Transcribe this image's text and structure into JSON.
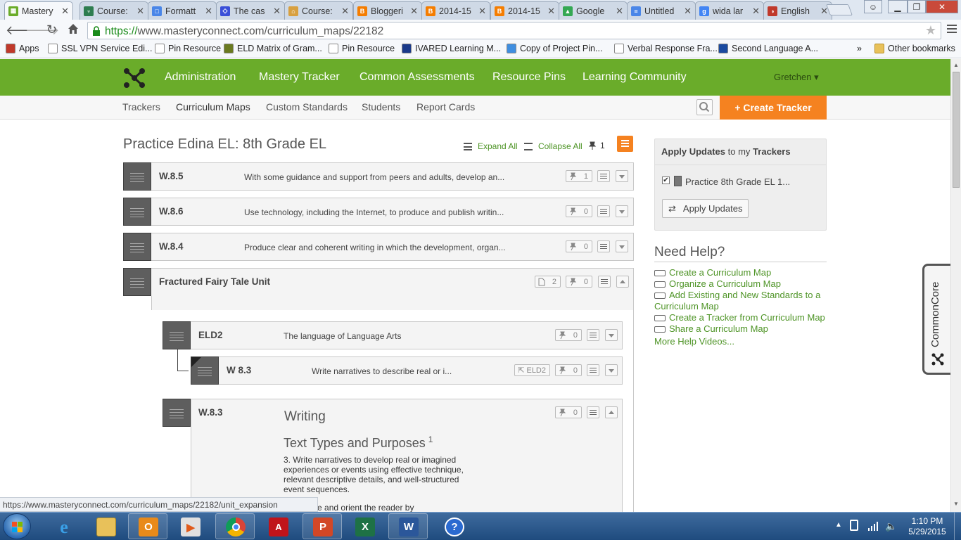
{
  "browser": {
    "tabs": [
      {
        "label": "Mastery",
        "color": "#6aac2a",
        "glyph": "▦"
      },
      {
        "label": "Course:",
        "color": "#2e7d4f",
        "glyph": "♆"
      },
      {
        "label": "Formatt",
        "color": "#4a86e8",
        "glyph": "□"
      },
      {
        "label": "The cas",
        "color": "#3a4fd8",
        "glyph": "◇"
      },
      {
        "label": "Course:",
        "color": "#d8a040",
        "glyph": "⌂"
      },
      {
        "label": "Bloggeri",
        "color": "#f57d00",
        "glyph": "B"
      },
      {
        "label": "2014-15",
        "color": "#f57d00",
        "glyph": "B"
      },
      {
        "label": "2014-15",
        "color": "#f57d00",
        "glyph": "B"
      },
      {
        "label": "Google",
        "color": "#34a853",
        "glyph": "▲"
      },
      {
        "label": "Untitled",
        "color": "#4a86e8",
        "glyph": "≡"
      },
      {
        "label": "wida lar",
        "color": "#4285f4",
        "glyph": "g"
      },
      {
        "label": "English",
        "color": "#c0392b",
        "glyph": "◑"
      }
    ],
    "url_https": "https://",
    "url_rest": "www.masteryconnect.com/curriculum_maps/22182",
    "bookmarks": [
      {
        "label": "Apps",
        "color": "#c0392b"
      },
      {
        "label": "SSL VPN Service Edi...",
        "color": "#ffffff"
      },
      {
        "label": "Pin Resource",
        "color": "#ffffff"
      },
      {
        "label": "ELD Matrix of Gram...",
        "color": "#6a7a20"
      },
      {
        "label": "Pin Resource",
        "color": "#ffffff"
      },
      {
        "label": "IVARED Learning M...",
        "color": "#1a3a8a"
      },
      {
        "label": "Copy of Project Pin...",
        "color": "#3f8ee0"
      },
      {
        "label": "Verbal Response Fra...",
        "color": "#ffffff"
      },
      {
        "label": "Second Language A...",
        "color": "#1a4aa0"
      }
    ],
    "bookmarks_more": "»",
    "other_bookmarks": "Other bookmarks",
    "status_url": "https://www.masteryconnect.com/curriculum_maps/22182/unit_expansion"
  },
  "nav": {
    "items": [
      "Administration",
      "Mastery Tracker",
      "Common Assessments",
      "Resource Pins",
      "Learning Community"
    ],
    "user": "Gretchen ▾",
    "subitems": [
      "Trackers",
      "Curriculum Maps",
      "Custom Standards",
      "Students",
      "Report Cards"
    ],
    "create_tracker": "+ Create Tracker"
  },
  "map": {
    "title": "Practice Edina EL: 8th Grade EL",
    "expand_all": "Expand All",
    "collapse_all": "Collapse All",
    "pin_count": "1",
    "rows": [
      {
        "code": "W.8.5",
        "desc": "With some guidance and support from peers and adults, develop an...",
        "pins": "1"
      },
      {
        "code": "W.8.6",
        "desc": "Use technology, including the Internet, to produce and publish writin...",
        "pins": "0"
      },
      {
        "code": "W.8.4",
        "desc": "Produce clear and coherent writing in which the development, organ...",
        "pins": "0"
      }
    ],
    "unit": {
      "title": "Fractured Fairy Tale Unit",
      "docs": "2",
      "pins": "0",
      "eld2": {
        "code": "ELD2",
        "desc": "The language of Language Arts",
        "pins": "0"
      },
      "w83_link": {
        "code": "W 8.3",
        "desc": "Write narratives to describe real or i...",
        "link_label": "⇱ ELD2",
        "pins": "0"
      },
      "w83_expanded": {
        "code": "W.8.3",
        "pins": "0",
        "heading": "Writing",
        "subheading": "Text Types and Purposes",
        "sup": "1",
        "body": "3. Write narratives to develop real or imagined experiences or events using effective technique, relevant descriptive details, and well-structured event sequences.",
        "body2": "a. Engage and orient the reader by"
      }
    }
  },
  "sidebar": {
    "apply_prefix": "Apply Updates",
    "apply_mid": "to my",
    "apply_suffix": "Trackers",
    "tracker_name": "Practice 8th Grade EL 1...",
    "apply_button": "Apply Updates",
    "help_title": "Need Help?",
    "help_links": [
      "Create a Curriculum Map",
      "Organize a Curriculum Map",
      "Add Existing and New Standards to a Curriculum Map",
      "Create a Tracker from Curriculum Map",
      "Share a Curriculum Map"
    ],
    "more_videos": "More Help Videos..."
  },
  "commoncore_tab": "CommonCore",
  "taskbar": {
    "time": "1:10 PM",
    "date": "5/29/2015"
  },
  "colors": {
    "brand_green": "#6aac2a",
    "accent_orange": "#f58220",
    "link_green": "#4e9426"
  }
}
